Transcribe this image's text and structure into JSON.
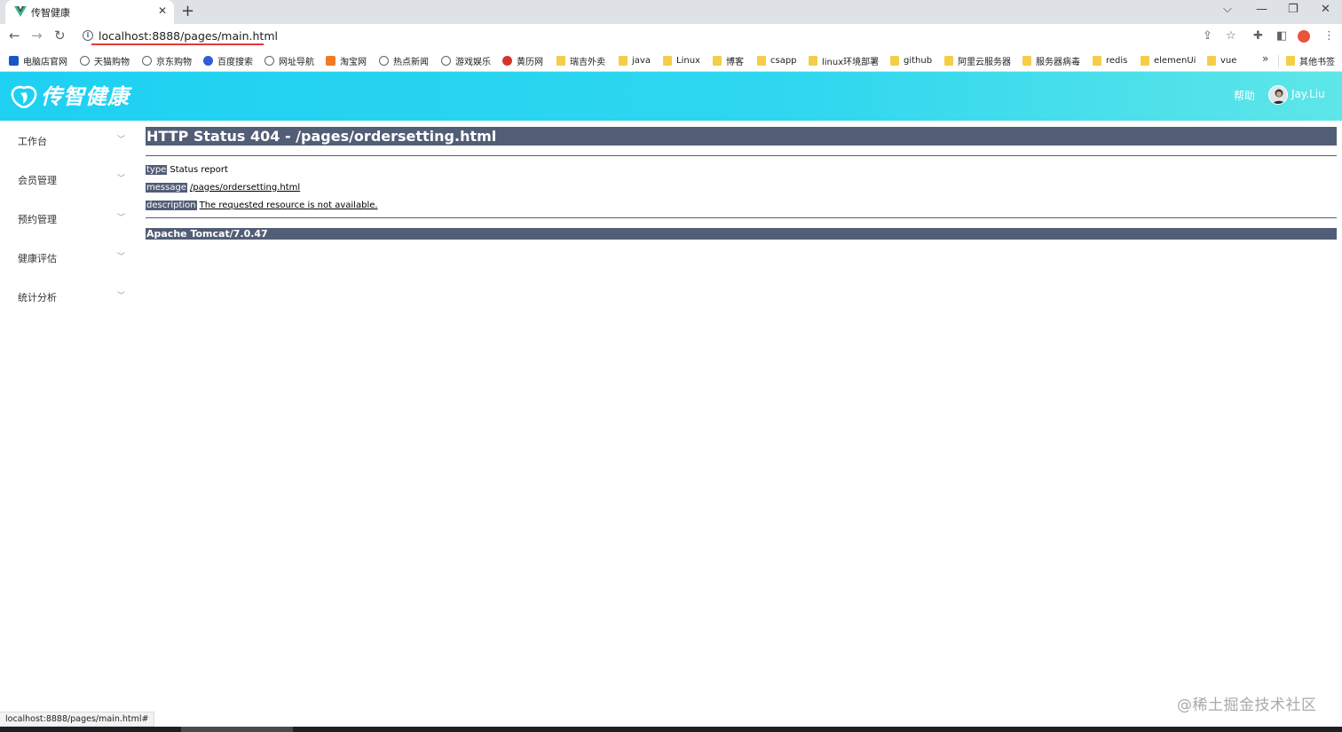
{
  "browser": {
    "tab_title": "传智健康",
    "new_tab": "+",
    "close_tab": "✕",
    "url": "localhost:8888/pages/main.html"
  },
  "window_controls": {
    "tab_search": "⌵",
    "minimize": "—",
    "restore": "❐",
    "close": "✕"
  },
  "bookmarks": [
    {
      "label": "电脑店官网",
      "icon": "blue-square-icon"
    },
    {
      "label": "天猫购物",
      "icon": "globe-icon"
    },
    {
      "label": "京东购物",
      "icon": "globe-icon"
    },
    {
      "label": "百度搜索",
      "icon": "baidu-paw-icon"
    },
    {
      "label": "网址导航",
      "icon": "globe-icon"
    },
    {
      "label": "淘宝网",
      "icon": "taobao-icon"
    },
    {
      "label": "热点新闻",
      "icon": "globe-icon"
    },
    {
      "label": "游戏娱乐",
      "icon": "globe-icon"
    },
    {
      "label": "黄历网",
      "icon": "red-circle-icon"
    },
    {
      "label": "瑞吉外卖",
      "icon": "folder-icon"
    },
    {
      "label": "java",
      "icon": "folder-icon"
    },
    {
      "label": "Linux",
      "icon": "folder-icon"
    },
    {
      "label": "博客",
      "icon": "folder-icon"
    },
    {
      "label": "csapp",
      "icon": "folder-icon"
    },
    {
      "label": "linux环境部署",
      "icon": "folder-icon"
    },
    {
      "label": "github",
      "icon": "folder-icon"
    },
    {
      "label": "阿里云服务器",
      "icon": "folder-icon"
    },
    {
      "label": "服务器病毒",
      "icon": "folder-icon"
    },
    {
      "label": "redis",
      "icon": "folder-icon"
    },
    {
      "label": "elemenUi",
      "icon": "folder-icon"
    },
    {
      "label": "vue",
      "icon": "folder-icon"
    }
  ],
  "bookmarks_more": "»",
  "other_bookmarks": "其他书签",
  "header": {
    "logo_text": "传智健康",
    "help": "帮助",
    "username": "Jay.Liu",
    "gradient_start": "#1ed0f2",
    "gradient_end": "#5ee6e8"
  },
  "sidebar": {
    "items": [
      {
        "label": "工作台"
      },
      {
        "label": "会员管理"
      },
      {
        "label": "预约管理"
      },
      {
        "label": "健康评估"
      },
      {
        "label": "统计分析"
      }
    ]
  },
  "error_page": {
    "title": "HTTP Status 404 - /pages/ordersetting.html",
    "type_label": "type",
    "type_value": "Status report",
    "message_label": "message",
    "message_value": "/pages/ordersetting.html",
    "description_label": "description",
    "description_value": "The requested resource is not available.",
    "server": "Apache Tomcat/7.0.47",
    "bar_color": "#525d76"
  },
  "status_bar": "localhost:8888/pages/main.html#",
  "watermark": "@稀土掘金技术社区"
}
